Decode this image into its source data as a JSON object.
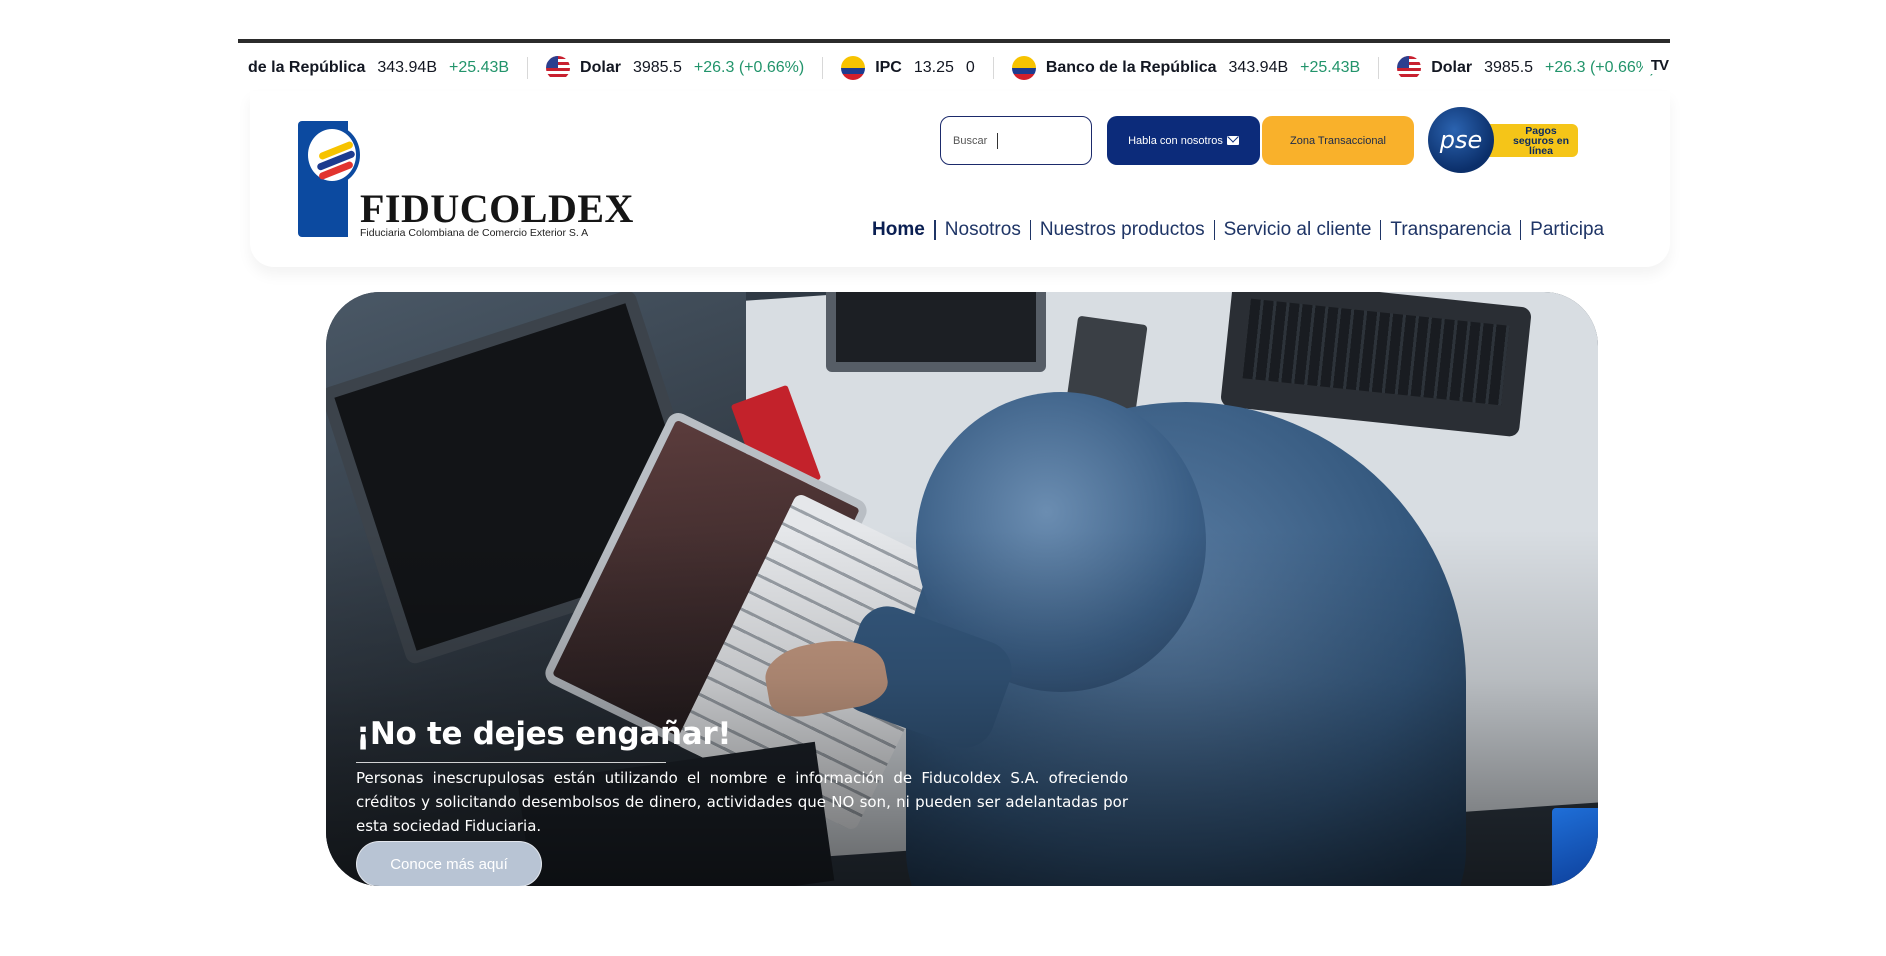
{
  "ticker": {
    "items": [
      {
        "name": "de la República",
        "price": "343.94B",
        "change": "+25.43B",
        "flag": "none"
      },
      {
        "name": "Dolar",
        "price": "3985.5",
        "change": "+26.3 (+0.66%)",
        "flag": "us"
      },
      {
        "name": "IPC",
        "price": "13.25",
        "change": "0",
        "flag": "co"
      },
      {
        "name": "Banco de la República",
        "price": "343.94B",
        "change": "+25.43B",
        "flag": "co"
      },
      {
        "name": "Dolar",
        "price": "3985.5",
        "change": "+26.3 (+0.66%)",
        "flag": "us"
      }
    ],
    "brand_icon": "tradingview-logo-icon",
    "brand_text": "TV",
    "change_color": "#22946b"
  },
  "header": {
    "logo": {
      "word": "FIDUCOLDEX",
      "subtitle": "Fiduciaria Colombiana de Comercio Exterior S. A"
    },
    "search": {
      "placeholder": "Buscar"
    },
    "contact_button": "Habla con nosotros",
    "zona_button": "Zona Transaccional",
    "pse": {
      "logo_text": "pse",
      "tagline": "Pagos seguros en línea"
    },
    "nav": [
      {
        "label": "Home",
        "active": true
      },
      {
        "label": "Nosotros",
        "active": false
      },
      {
        "label": "Nuestros productos",
        "active": false
      },
      {
        "label": "Servicio al cliente",
        "active": false
      },
      {
        "label": "Transparencia",
        "active": false
      },
      {
        "label": "Participa",
        "active": false
      }
    ],
    "colors": {
      "primary": "#0c2b7a",
      "accent": "#f9b12b"
    }
  },
  "hero": {
    "title": "¡No te dejes engañar!",
    "text": "Personas inescrupulosas están utilizando el nombre e información de Fiducoldex S.A. ofreciendo créditos y solicitando desembolsos de dinero, actividades que NO son, ni pueden ser adelantadas por esta sociedad Fiduciaria.",
    "button": "Conoce más aquí"
  }
}
